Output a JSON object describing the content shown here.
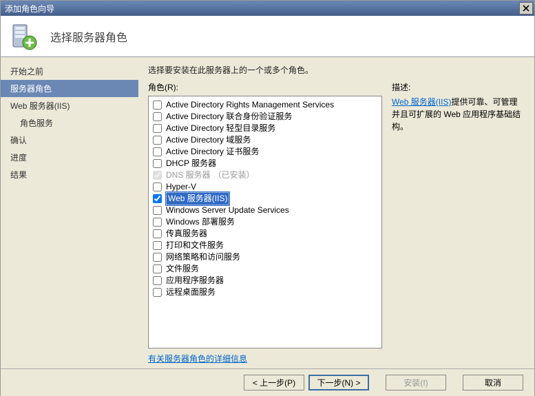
{
  "window": {
    "title": "添加角色向导"
  },
  "header": {
    "title": "选择服务器角色"
  },
  "sidebar": {
    "items": [
      {
        "label": "开始之前",
        "indent": 0,
        "active": false
      },
      {
        "label": "服务器角色",
        "indent": 0,
        "active": true
      },
      {
        "label": "Web 服务器(IIS)",
        "indent": 0,
        "active": false
      },
      {
        "label": "角色服务",
        "indent": 1,
        "active": false
      },
      {
        "label": "确认",
        "indent": 0,
        "active": false
      },
      {
        "label": "进度",
        "indent": 0,
        "active": false
      },
      {
        "label": "结果",
        "indent": 0,
        "active": false
      }
    ]
  },
  "main": {
    "instruction": "选择要安装在此服务器上的一个或多个角色。",
    "roles_label": "角色(R):",
    "desc_label": "描述:",
    "desc_link_text": "Web 服务器(IIS)",
    "desc_rest": "提供可靠、可管理并且可扩展的 Web 应用程序基础结构。",
    "more_link": "有关服务器角色的详细信息",
    "roles": [
      {
        "label": "Active Directory Rights Management Services",
        "checked": false,
        "installed": false,
        "selected": false
      },
      {
        "label": "Active Directory 联合身份验证服务",
        "checked": false,
        "installed": false,
        "selected": false
      },
      {
        "label": "Active Directory 轻型目录服务",
        "checked": false,
        "installed": false,
        "selected": false
      },
      {
        "label": "Active Directory 域服务",
        "checked": false,
        "installed": false,
        "selected": false
      },
      {
        "label": "Active Directory 证书服务",
        "checked": false,
        "installed": false,
        "selected": false
      },
      {
        "label": "DHCP 服务器",
        "checked": false,
        "installed": false,
        "selected": false
      },
      {
        "label": "DNS 服务器",
        "checked": true,
        "installed": true,
        "selected": false,
        "suffix": "（已安装）"
      },
      {
        "label": "Hyper-V",
        "checked": false,
        "installed": false,
        "selected": false
      },
      {
        "label": "Web 服务器(IIS)",
        "checked": true,
        "installed": false,
        "selected": true
      },
      {
        "label": "Windows Server Update Services",
        "checked": false,
        "installed": false,
        "selected": false
      },
      {
        "label": "Windows 部署服务",
        "checked": false,
        "installed": false,
        "selected": false
      },
      {
        "label": "传真服务器",
        "checked": false,
        "installed": false,
        "selected": false
      },
      {
        "label": "打印和文件服务",
        "checked": false,
        "installed": false,
        "selected": false
      },
      {
        "label": "网络策略和访问服务",
        "checked": false,
        "installed": false,
        "selected": false
      },
      {
        "label": "文件服务",
        "checked": false,
        "installed": false,
        "selected": false
      },
      {
        "label": "应用程序服务器",
        "checked": false,
        "installed": false,
        "selected": false
      },
      {
        "label": "远程桌面服务",
        "checked": false,
        "installed": false,
        "selected": false
      }
    ]
  },
  "footer": {
    "prev": "< 上一步(P)",
    "next": "下一步(N) >",
    "install": "安装(I)",
    "cancel": "取消"
  }
}
